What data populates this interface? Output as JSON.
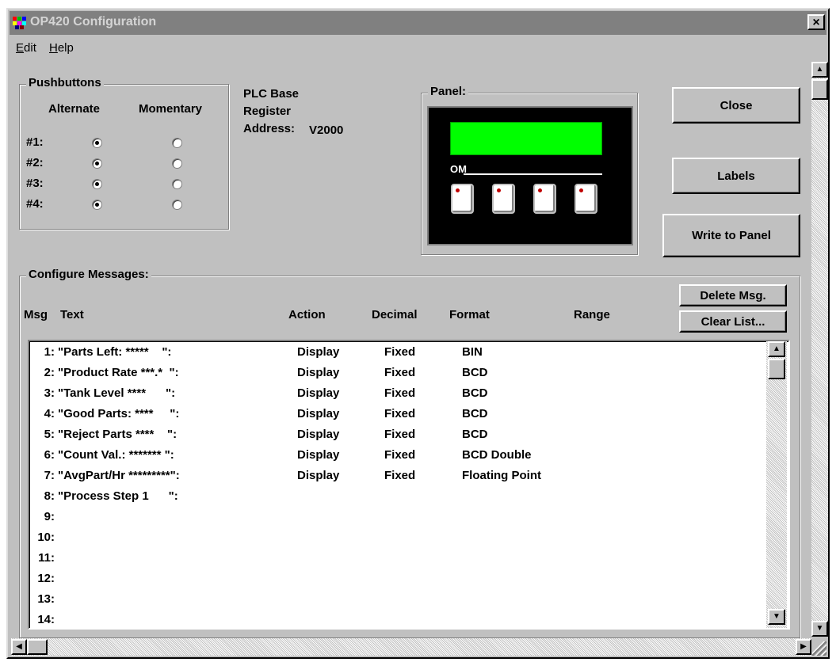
{
  "window": {
    "title": "OP420 Configuration",
    "close_glyph": "×"
  },
  "menu": {
    "edit": "Edit",
    "help": "Help"
  },
  "pushbuttons": {
    "legend": "Pushbuttons",
    "col_alternate": "Alternate",
    "col_momentary": "Momentary",
    "rows": [
      {
        "label": "#1:",
        "selected": "alternate"
      },
      {
        "label": "#2:",
        "selected": "alternate"
      },
      {
        "label": "#3:",
        "selected": "alternate"
      },
      {
        "label": "#4:",
        "selected": "alternate"
      }
    ]
  },
  "plc": {
    "line1": "PLC Base",
    "line2": "Register",
    "address_label": "Address:",
    "address_value": "V2000"
  },
  "panel": {
    "legend": "Panel:",
    "indicator": "OM",
    "lcd_color": "#00ff00",
    "key_count": 4
  },
  "buttons": {
    "close": "Close",
    "labels": "Labels",
    "write_to_panel": "Write to Panel",
    "delete_msg": "Delete Msg.",
    "clear_list": "Clear List..."
  },
  "messages": {
    "legend": "Configure Messages:",
    "headers": {
      "msg": "Msg",
      "text": "Text",
      "action": "Action",
      "decimal": "Decimal",
      "format": "Format",
      "range": "Range"
    },
    "rows": [
      {
        "num": "1:",
        "text": "\"Parts Left: *****    \":",
        "action": "Display",
        "decimal": "Fixed",
        "format": "BIN"
      },
      {
        "num": "2:",
        "text": "\"Product Rate ***.*  \":",
        "action": "Display",
        "decimal": "Fixed",
        "format": "BCD"
      },
      {
        "num": "3:",
        "text": "\"Tank Level ****      \":",
        "action": "Display",
        "decimal": "Fixed",
        "format": "BCD"
      },
      {
        "num": "4:",
        "text": "\"Good Parts: ****     \":",
        "action": "Display",
        "decimal": "Fixed",
        "format": "BCD"
      },
      {
        "num": "5:",
        "text": "\"Reject Parts ****    \":",
        "action": "Display",
        "decimal": "Fixed",
        "format": "BCD"
      },
      {
        "num": "6:",
        "text": "\"Count Val.: ******* \":",
        "action": "Display",
        "decimal": "Fixed",
        "format": "BCD Double"
      },
      {
        "num": "7:",
        "text": "\"AvgPart/Hr *********\":",
        "action": "Display",
        "decimal": "Fixed",
        "format": "Floating Point"
      },
      {
        "num": "8:",
        "text": "\"Process Step 1      \":",
        "action": "",
        "decimal": "",
        "format": ""
      },
      {
        "num": "9:",
        "text": "",
        "action": "",
        "decimal": "",
        "format": ""
      },
      {
        "num": "10:",
        "text": "",
        "action": "",
        "decimal": "",
        "format": ""
      },
      {
        "num": "11:",
        "text": "",
        "action": "",
        "decimal": "",
        "format": ""
      },
      {
        "num": "12:",
        "text": "",
        "action": "",
        "decimal": "",
        "format": ""
      },
      {
        "num": "13:",
        "text": "",
        "action": "",
        "decimal": "",
        "format": ""
      },
      {
        "num": "14:",
        "text": "",
        "action": "",
        "decimal": "",
        "format": ""
      }
    ]
  },
  "scroll": {
    "up": "▲",
    "down": "▼",
    "left": "◀",
    "right": "▶"
  }
}
